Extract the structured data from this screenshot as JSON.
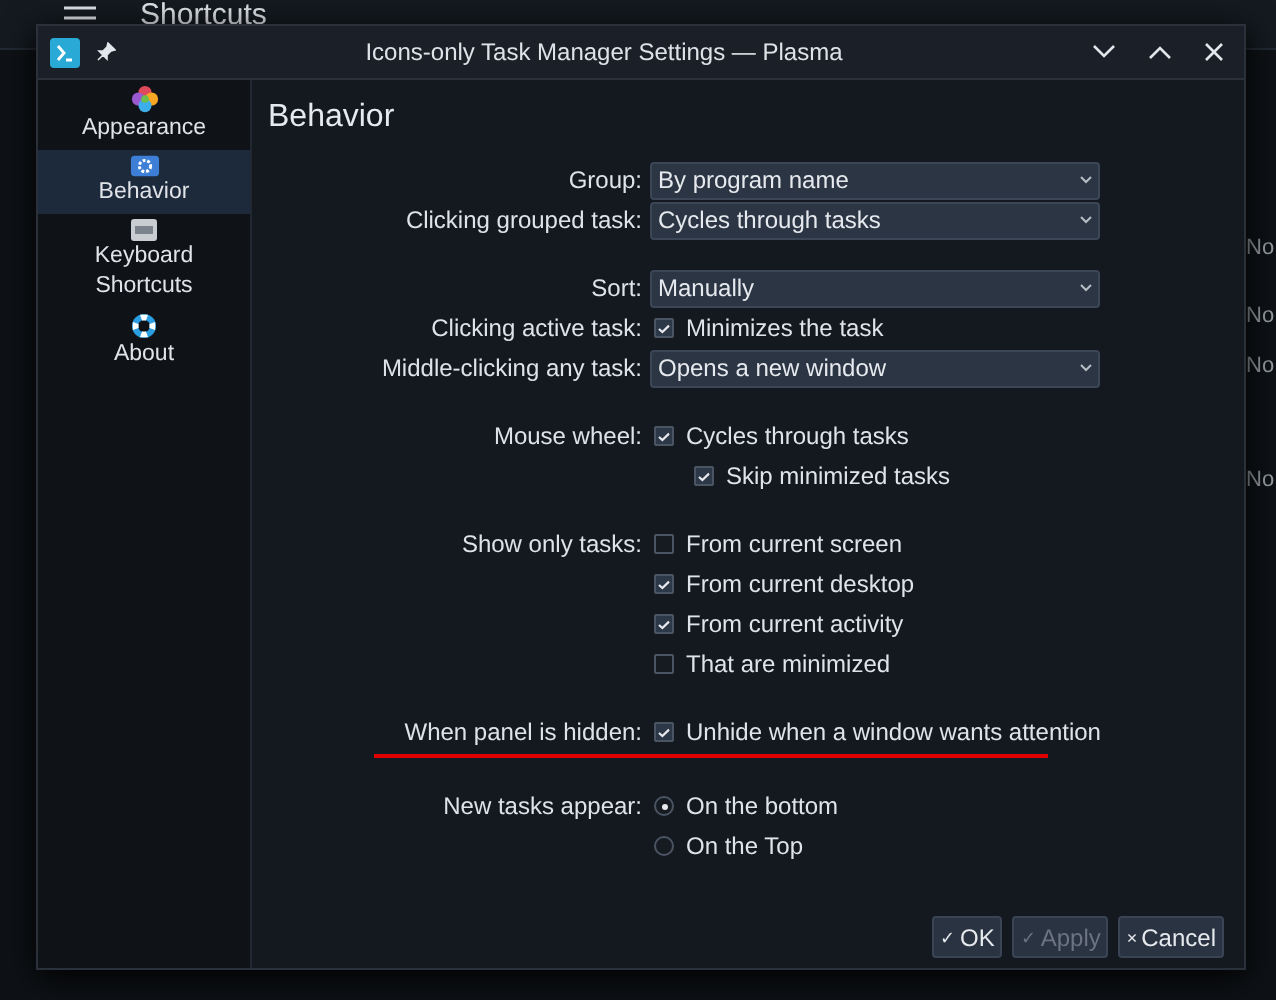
{
  "background_app": {
    "title": "Shortcuts",
    "column_text": [
      "No",
      "No",
      "No",
      "No"
    ]
  },
  "window": {
    "title": "Icons-only Task Manager Settings — Plasma"
  },
  "sidebar": {
    "items": [
      {
        "label": "Appearance",
        "selected": false
      },
      {
        "label": "Behavior",
        "selected": true
      },
      {
        "label": "Keyboard Shortcuts",
        "selected": false
      },
      {
        "label": "About",
        "selected": false
      }
    ]
  },
  "page": {
    "heading": "Behavior",
    "sections": [
      {
        "rows": [
          {
            "label": "Group:",
            "kind": "select",
            "value": "By program name"
          },
          {
            "label": "Clicking grouped task:",
            "kind": "select",
            "value": "Cycles through tasks"
          }
        ]
      },
      {
        "rows": [
          {
            "label": "Sort:",
            "kind": "select",
            "value": "Manually"
          },
          {
            "label": "Clicking active task:",
            "kind": "checkbox",
            "text": "Minimizes the task",
            "checked": true
          },
          {
            "label": "Middle-clicking any task:",
            "kind": "select",
            "value": "Opens a new window"
          }
        ]
      },
      {
        "rows": [
          {
            "label": "Mouse wheel:",
            "kind": "checkbox",
            "text": "Cycles through tasks",
            "checked": true,
            "children": [
              {
                "kind": "checkbox",
                "text": "Skip minimized tasks",
                "checked": true
              }
            ]
          }
        ]
      },
      {
        "rows": [
          {
            "label": "Show only tasks:",
            "kind": "checkbox",
            "text": "From current screen",
            "checked": false
          },
          {
            "kind": "checkbox",
            "text": "From current desktop",
            "checked": true
          },
          {
            "kind": "checkbox",
            "text": "From current activity",
            "checked": true
          },
          {
            "kind": "checkbox",
            "text": "That are minimized",
            "checked": false
          }
        ]
      },
      {
        "rows": [
          {
            "label": "When panel is hidden:",
            "kind": "checkbox",
            "text": "Unhide when a window wants attention",
            "checked": true,
            "underlined": true
          }
        ]
      },
      {
        "rows": [
          {
            "label": "New tasks appear:",
            "kind": "radio",
            "text": "On the bottom",
            "selected": true
          },
          {
            "kind": "radio",
            "text": "On the Top",
            "selected": false
          }
        ]
      }
    ]
  },
  "buttons": [
    {
      "symbol": "✓",
      "label": "OK",
      "disabled": false
    },
    {
      "symbol": "✓",
      "label": "Apply",
      "disabled": true
    },
    {
      "symbol": "×",
      "label": "Cancel",
      "disabled": false
    }
  ]
}
